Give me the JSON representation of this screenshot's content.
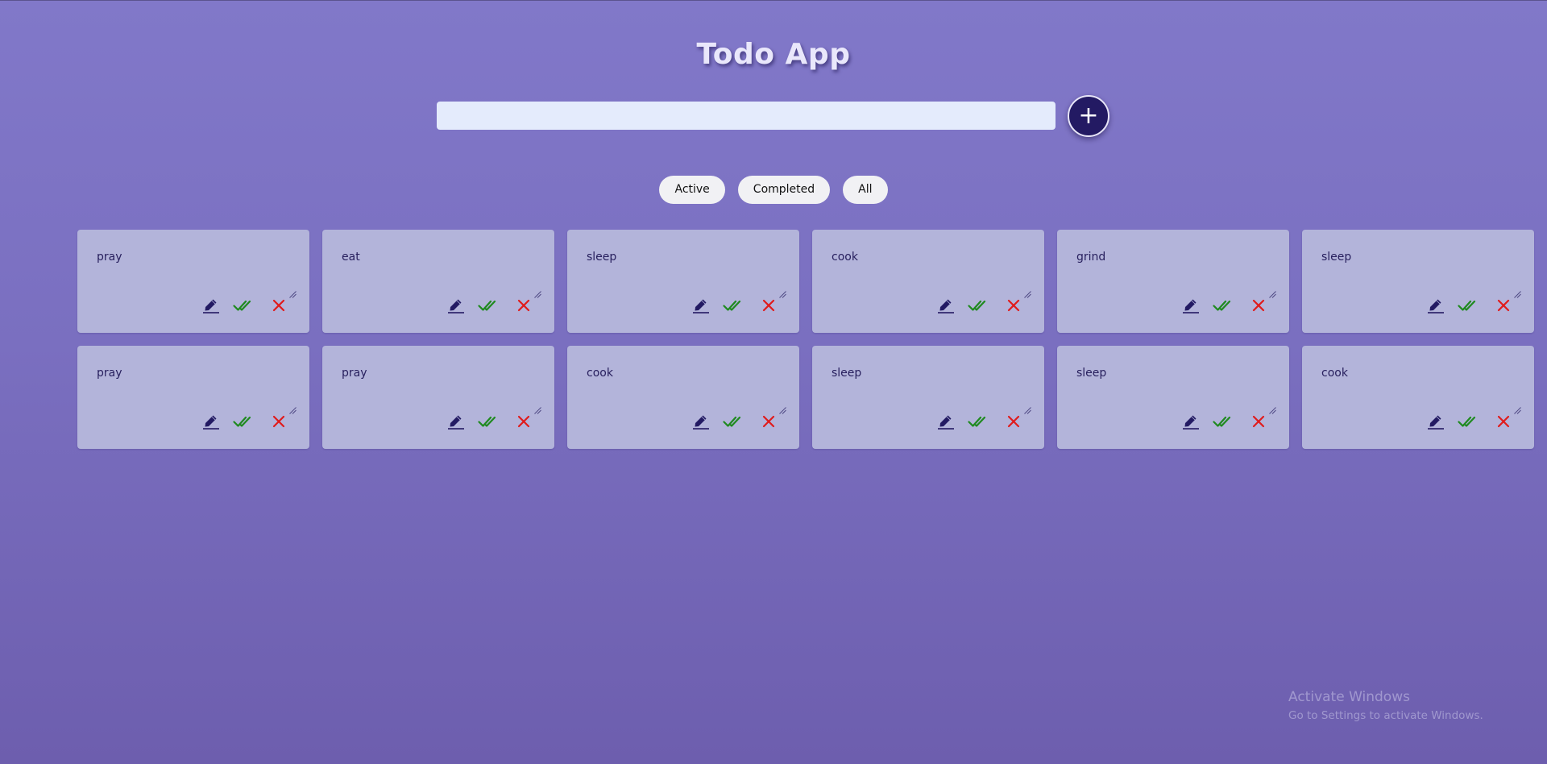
{
  "app": {
    "title": "Todo App"
  },
  "input": {
    "value": "",
    "placeholder": ""
  },
  "add_button": {
    "label": "+"
  },
  "filters": [
    {
      "label": "Active"
    },
    {
      "label": "Completed"
    },
    {
      "label": "All"
    }
  ],
  "todos": [
    {
      "text": "pray"
    },
    {
      "text": "eat"
    },
    {
      "text": "sleep"
    },
    {
      "text": "cook"
    },
    {
      "text": "grind"
    },
    {
      "text": "sleep"
    },
    {
      "text": "pray"
    },
    {
      "text": "pray"
    },
    {
      "text": "cook"
    },
    {
      "text": "sleep"
    },
    {
      "text": "sleep"
    },
    {
      "text": "cook"
    }
  ],
  "card_actions": [
    "pencil-icon",
    "double-check-icon",
    "close-icon"
  ],
  "colors": {
    "background_top": "#8178c9",
    "background_bottom": "#6d5eae",
    "card": "#b3b4da",
    "card_text": "#28205e",
    "edit_icon": "#231a63",
    "complete_icon": "#1f8a1f",
    "delete_icon": "#e01b1b",
    "add_button": "#231a63",
    "input": "#e4ebfc"
  },
  "watermark": {
    "title": "Activate Windows",
    "subtitle": "Go to Settings to activate Windows."
  }
}
